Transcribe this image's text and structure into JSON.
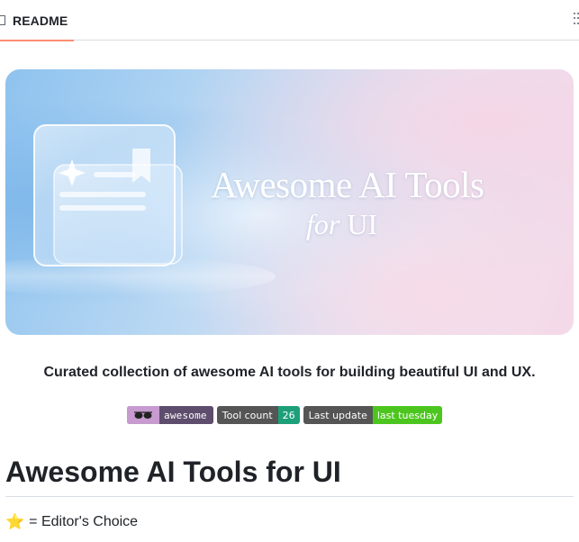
{
  "tabbar": {
    "tab_label": "README"
  },
  "banner": {
    "title": "Awesome AI Tools",
    "subtitle_italic": "for",
    "subtitle_rest": " UI"
  },
  "tagline": "Curated collection of awesome AI tools for building beautiful UI and UX.",
  "badges": [
    {
      "label": "",
      "value": "awesome",
      "value_color": "#5e4d6d",
      "icon": "sunglasses-icon"
    },
    {
      "label": "Tool count",
      "value": "26",
      "value_color": "#1da07a"
    },
    {
      "label": "Last update",
      "value": "last tuesday",
      "value_color": "#4cc61e"
    }
  ],
  "heading": "Awesome AI Tools for UI",
  "legend": {
    "icon": "star-icon",
    "star_glyph": "⭐",
    "text": "= Editor's Choice"
  },
  "colors": {
    "tab_accent": "#fd8c73",
    "badge_label_bg": "#555555"
  }
}
